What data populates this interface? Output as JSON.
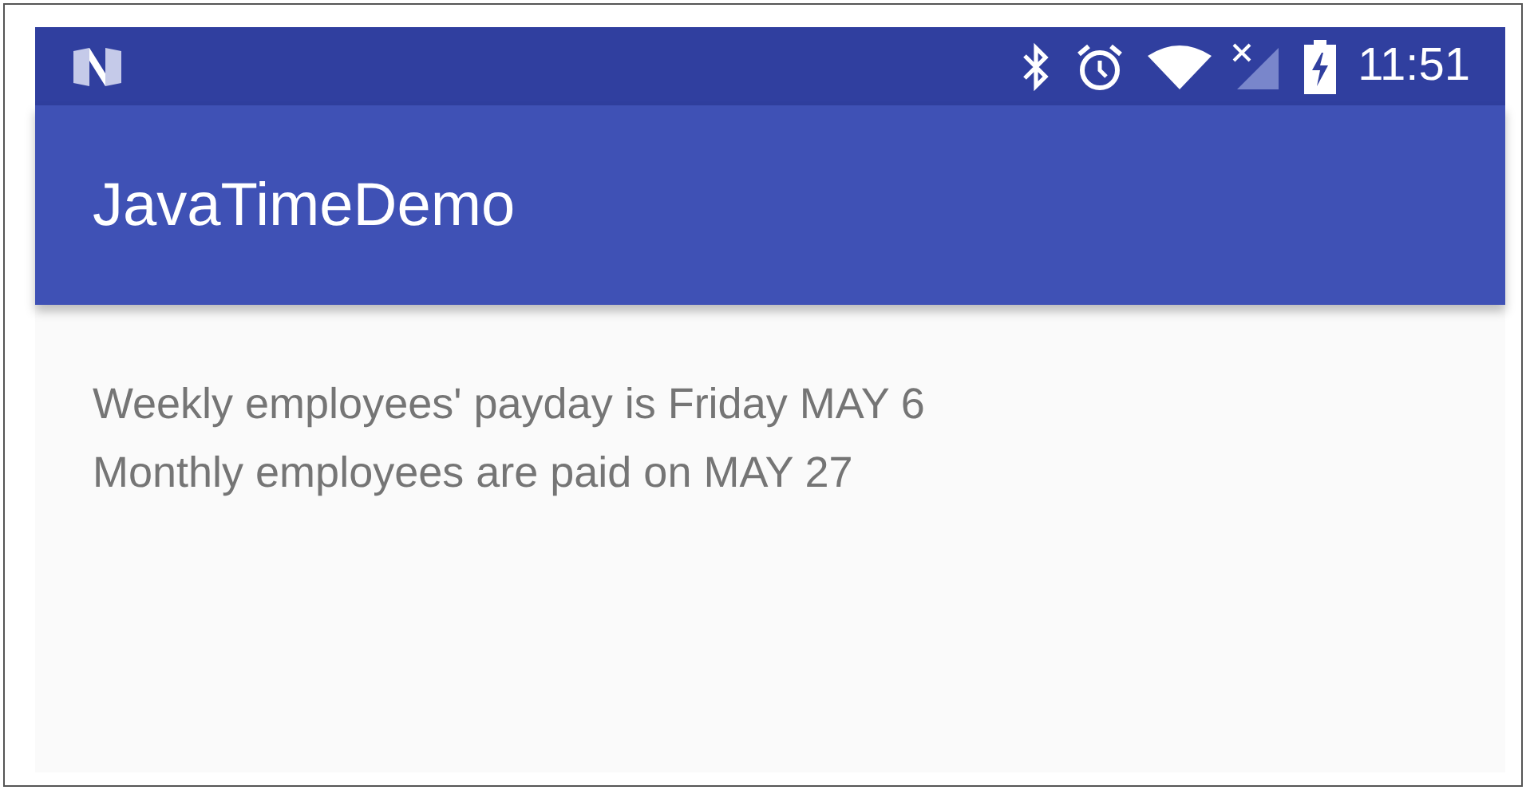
{
  "status_bar": {
    "time": "11:51"
  },
  "app_bar": {
    "title": "JavaTimeDemo"
  },
  "content": {
    "lines": [
      "Weekly employees' payday is Friday MAY 6",
      "Monthly employees are paid on MAY 27"
    ]
  }
}
